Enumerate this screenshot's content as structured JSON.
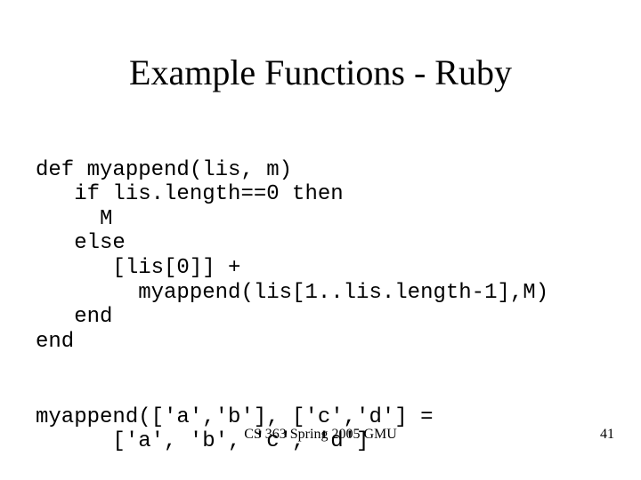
{
  "title": "Example Functions - Ruby",
  "code": {
    "l1": "def myappend(lis, m)",
    "l2": "   if lis.length==0 then",
    "l3": "     M",
    "l4": "   else",
    "l5": "      [lis[0]] +",
    "l6": "        myappend(lis[1..lis.length-1],M)",
    "l7": "   end",
    "l8": "end"
  },
  "example": {
    "l1": "myappend(['a','b'], ['c','d'] =",
    "l2": "      ['a', 'b', 'c', 'd']"
  },
  "footer": {
    "center": "CS 363 Spring 2005 GMU",
    "page": "41"
  }
}
